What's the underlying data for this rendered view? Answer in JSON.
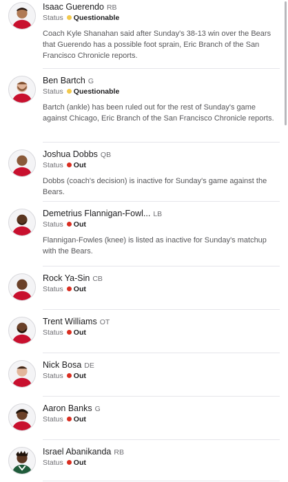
{
  "status_label": "Status",
  "colors": {
    "questionable": "#f2c94c",
    "out": "#d92d20"
  },
  "players": [
    {
      "name": "Isaac Guerendo",
      "position": "RB",
      "status": "Questionable",
      "status_color": "#f2c94c",
      "note": "Coach Kyle Shanahan said after Sunday's 38-13 win over the Bears that Guerendo has a possible foot sprain, Eric Branch of the San Francisco Chronicle reports.",
      "avatar_icon": "player-headshot-icon"
    },
    {
      "name": "Ben Bartch",
      "position": "G",
      "status": "Questionable",
      "status_color": "#f2c94c",
      "note": "Bartch (ankle) has been ruled out for the rest of Sunday's game against Chicago, Eric Branch of the San Francisco Chronicle reports.",
      "avatar_icon": "player-headshot-icon"
    },
    {
      "name": "Joshua Dobbs",
      "position": "QB",
      "status": "Out",
      "status_color": "#d92d20",
      "note": "Dobbs (coach's decision) is inactive for Sunday's game against the Bears.",
      "avatar_icon": "player-headshot-icon"
    },
    {
      "name": "Demetrius Flannigan-Fowl...",
      "position": "LB",
      "status": "Out",
      "status_color": "#d92d20",
      "note": "Flannigan-Fowles (knee) is listed as inactive for Sunday's matchup with the Bears.",
      "avatar_icon": "player-headshot-icon"
    },
    {
      "name": "Rock Ya-Sin",
      "position": "CB",
      "status": "Out",
      "status_color": "#d92d20",
      "avatar_icon": "player-headshot-icon"
    },
    {
      "name": "Trent Williams",
      "position": "OT",
      "status": "Out",
      "status_color": "#d92d20",
      "avatar_icon": "player-headshot-icon"
    },
    {
      "name": "Nick Bosa",
      "position": "DE",
      "status": "Out",
      "status_color": "#d92d20",
      "avatar_icon": "player-headshot-icon"
    },
    {
      "name": "Aaron Banks",
      "position": "G",
      "status": "Out",
      "status_color": "#d92d20",
      "avatar_icon": "player-headshot-icon"
    },
    {
      "name": "Israel Abanikanda",
      "position": "RB",
      "status": "Out",
      "status_color": "#d92d20",
      "avatar_icon": "player-headshot-icon"
    }
  ]
}
